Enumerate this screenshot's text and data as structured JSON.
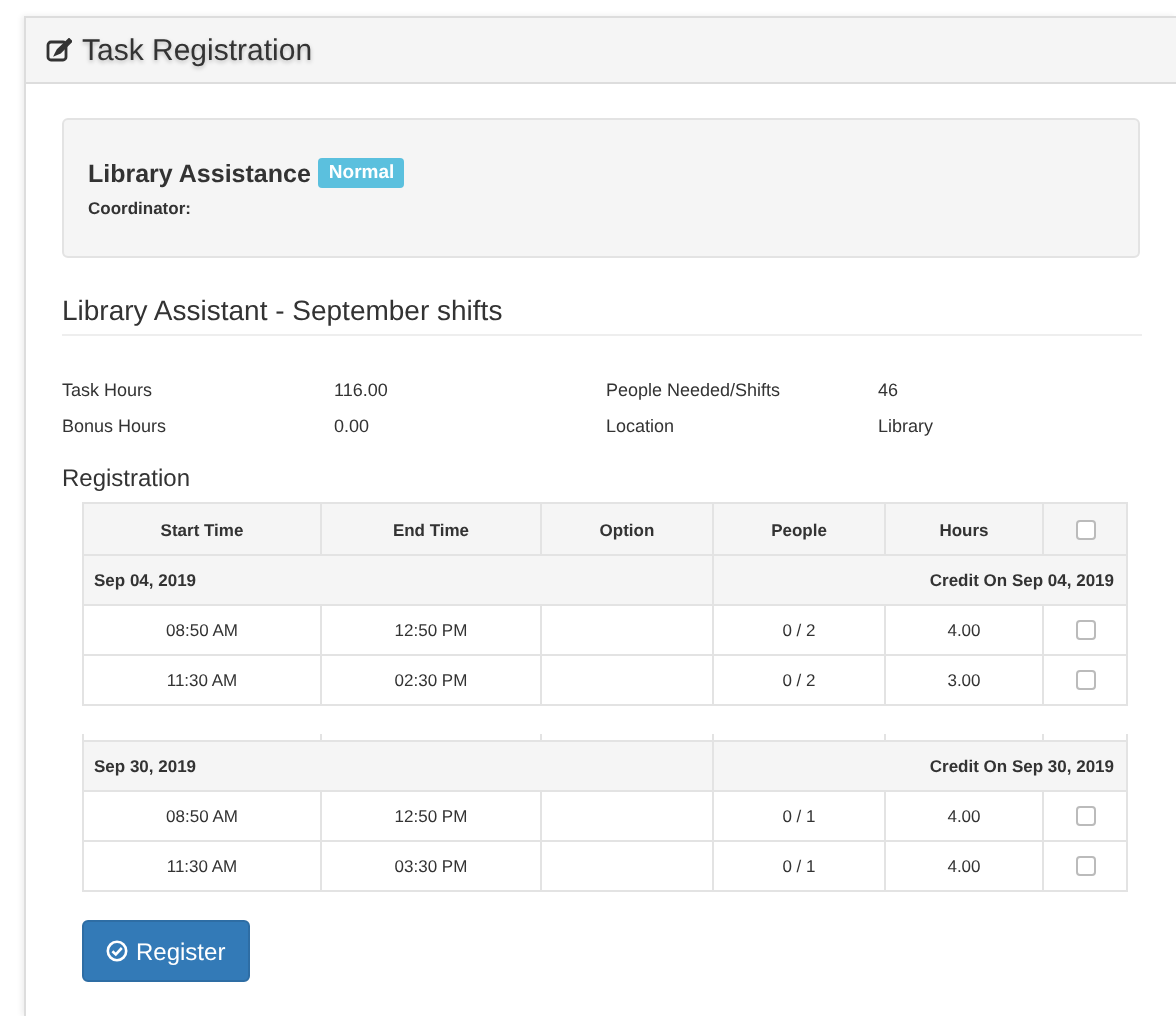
{
  "panel": {
    "title": "Task Registration"
  },
  "task": {
    "name": "Library Assistance",
    "badge": "Normal",
    "coordinator_label": "Coordinator:"
  },
  "subtitle": "Library Assistant - September shifts",
  "info": [
    {
      "label": "Task Hours",
      "value": "116.00"
    },
    {
      "label": "People Needed/Shifts",
      "value": "46"
    },
    {
      "label": "Bonus Hours",
      "value": "0.00"
    },
    {
      "label": "Location",
      "value": "Library"
    }
  ],
  "registration": {
    "heading": "Registration",
    "columns": [
      "Start Time",
      "End Time",
      "Option",
      "People",
      "Hours"
    ],
    "select_all": {
      "checked": false
    },
    "segments": [
      {
        "groups": [
          {
            "date": "Sep 04, 2019",
            "credit": "Credit On Sep 04, 2019",
            "rows": [
              {
                "start": "08:50 AM",
                "end": "12:50 PM",
                "option": "",
                "people": "0 / 2",
                "hours": "4.00",
                "checked": false
              },
              {
                "start": "11:30 AM",
                "end": "02:30 PM",
                "option": "",
                "people": "0 / 2",
                "hours": "3.00",
                "checked": false
              }
            ]
          }
        ]
      },
      {
        "groups": [
          {
            "date": "Sep 30, 2019",
            "credit": "Credit On Sep 30, 2019",
            "rows": [
              {
                "start": "08:50 AM",
                "end": "12:50 PM",
                "option": "",
                "people": "0 / 1",
                "hours": "4.00",
                "checked": false
              },
              {
                "start": "11:30 AM",
                "end": "03:30 PM",
                "option": "",
                "people": "0 / 1",
                "hours": "4.00",
                "checked": false
              }
            ]
          }
        ]
      }
    ]
  },
  "register_button": {
    "label": "Register"
  }
}
